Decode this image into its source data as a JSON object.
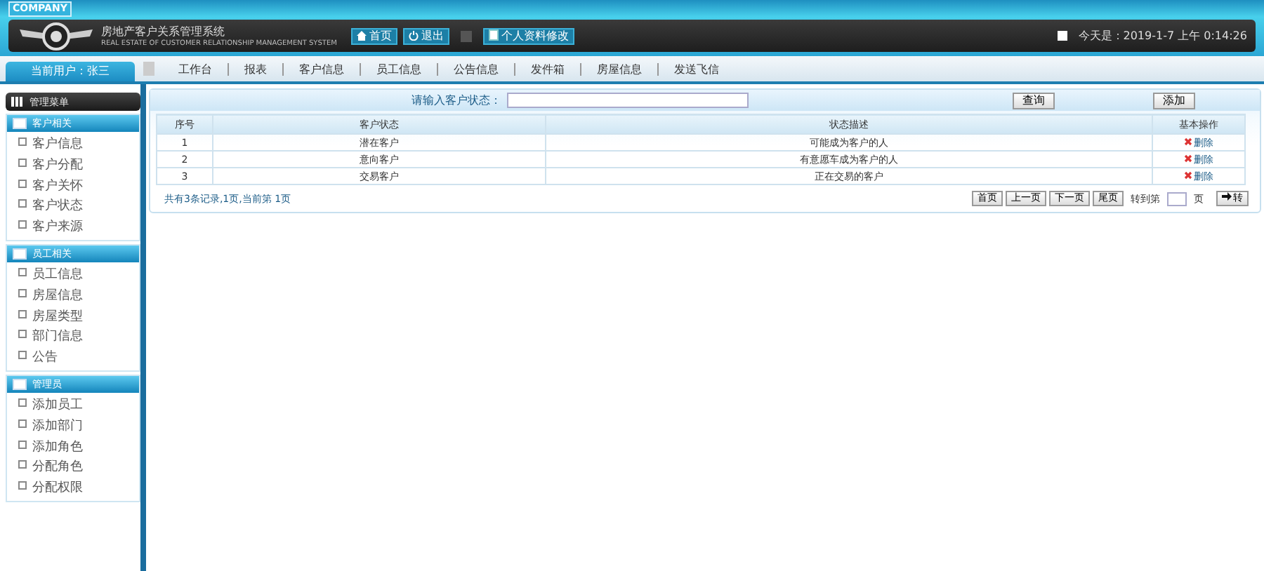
{
  "header": {
    "company": "COMPANY",
    "title": "房地产客户关系管理系统",
    "subtitle": "REAL ESTATE OF CUSTOMER RELATIONSHIP MANAGEMENT SYSTEM",
    "buttons": [
      "首页",
      "退出"
    ],
    "profile_button": "个人资料修改",
    "date": "今天是：2019-1-7 上午 0:14:26"
  },
  "nav": {
    "user": "当前用户：张三",
    "items": [
      "工作台",
      "报表",
      "客户信息",
      "员工信息",
      "公告信息",
      "发件箱",
      "房屋信息",
      "发送飞信"
    ]
  },
  "sidebar": {
    "title": "管理菜单",
    "groups": [
      {
        "title": "客户相关",
        "items": [
          "客户信息",
          "客户分配",
          "客户关怀",
          "客户状态",
          "客户来源"
        ]
      },
      {
        "title": "员工相关",
        "items": [
          "员工信息",
          "房屋信息",
          "房屋类型",
          "部门信息",
          "公告"
        ]
      },
      {
        "title": "管理员",
        "items": [
          "添加员工",
          "添加部门",
          "添加角色",
          "分配角色",
          "分配权限"
        ]
      }
    ]
  },
  "search": {
    "label": "请输入客户状态：",
    "query_button": "查询",
    "add_button": "添加"
  },
  "table": {
    "columns": [
      "序号",
      "客户状态",
      "状态描述",
      "基本操作"
    ],
    "rows": [
      {
        "index": "1",
        "status": "潜在客户",
        "description": "可能成为客户的人",
        "action": "删除"
      },
      {
        "index": "2",
        "status": "意向客户",
        "description": "有意愿车成为客户的人",
        "action": "删除"
      },
      {
        "index": "3",
        "status": "交易客户",
        "description": "正在交易的客户",
        "action": "删除"
      }
    ]
  },
  "pager": {
    "summary": "共有3条记录,1页,当前第 1页",
    "buttons": [
      "首页",
      "上一页",
      "下一页",
      "尾页"
    ],
    "goto_label": "转到第",
    "page_unit": "页",
    "go_button": "转"
  }
}
